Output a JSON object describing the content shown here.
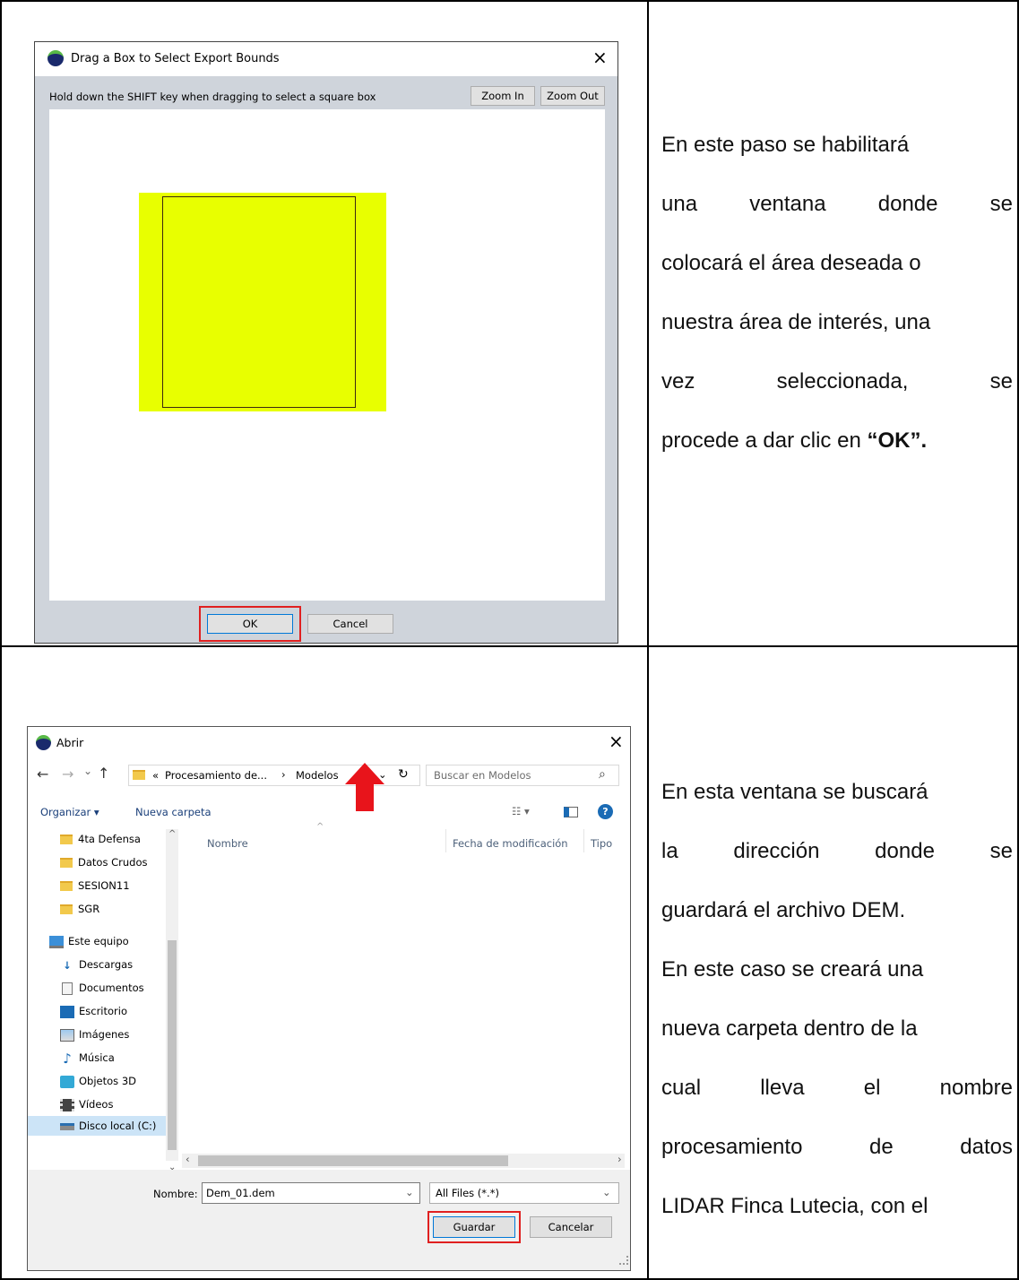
{
  "dialog1": {
    "title": "Drag a Box to Select Export Bounds",
    "instruction": "Hold down the SHIFT key when dragging to select a square box",
    "zoom_in": "Zoom In",
    "zoom_out": "Zoom Out",
    "ok": "OK",
    "cancel": "Cancel",
    "close": "×",
    "colors": {
      "selection_fill": "#e8ff00",
      "highlight": "#e02020"
    }
  },
  "desc1": {
    "lines": [
      "En este paso se habilitará",
      "una ventana donde se",
      "colocará el área deseada o",
      "nuestra área de interés, una",
      "vez seleccionada, se"
    ],
    "last_prefix": "procede a dar clic en ",
    "last_bold": "“OK”."
  },
  "dialog2": {
    "title": "Abrir",
    "close": "×",
    "nav_back": "←",
    "nav_forward": "→",
    "nav_recent": "⌄",
    "nav_up": "↑",
    "path_prefix": "«",
    "path_1": "Procesamiento de...",
    "path_sep": "›",
    "path_2": "Modelos",
    "path_dropdown": "⌄",
    "refresh": "↻",
    "search_placeholder": "Buscar en Modelos",
    "search_icon": "⌕",
    "organize": "Organizar ▾",
    "new_folder": "Nueva carpeta",
    "view_icon": "☷ ▾",
    "help_icon": "?",
    "columns": [
      "Nombre",
      "Fecha de modificación",
      "Tipo"
    ],
    "sort_caret": "^",
    "scroll_up": "^",
    "scroll_down": "⌄",
    "scroll_left": "‹",
    "scroll_right": "›",
    "sidebar": [
      {
        "label": "4ta Defensa",
        "icon": "folder-icon"
      },
      {
        "label": "Datos Crudos",
        "icon": "folder-icon"
      },
      {
        "label": "SESION11",
        "icon": "folder-icon"
      },
      {
        "label": "SGR",
        "icon": "folder-icon"
      },
      {
        "label": "Este equipo",
        "icon": "computer-icon"
      },
      {
        "label": "Descargas",
        "icon": "download-icon"
      },
      {
        "label": "Documentos",
        "icon": "document-icon"
      },
      {
        "label": "Escritorio",
        "icon": "desktop-icon"
      },
      {
        "label": "Imágenes",
        "icon": "pictures-icon"
      },
      {
        "label": "Música",
        "icon": "music-icon"
      },
      {
        "label": "Objetos 3D",
        "icon": "cube-icon"
      },
      {
        "label": "Vídeos",
        "icon": "video-icon"
      },
      {
        "label": "Disco local (C:)",
        "icon": "disk-icon"
      }
    ],
    "filename_label": "Nombre:",
    "filename_value": "Dem_01.dem",
    "filter_value": "All Files (*.*)",
    "dropdown_arrow": "⌄",
    "save": "Guardar",
    "cancel": "Cancelar",
    "arrow_color": "#e8141b"
  },
  "desc2": {
    "lines": [
      "En esta ventana se buscará",
      "la dirección donde se",
      "guardará el archivo DEM.",
      "En este caso se creará una",
      "nueva carpeta dentro de la",
      "cual lleva el nombre",
      "procesamiento de datos",
      "LIDAR Finca Lutecia, con el"
    ]
  }
}
